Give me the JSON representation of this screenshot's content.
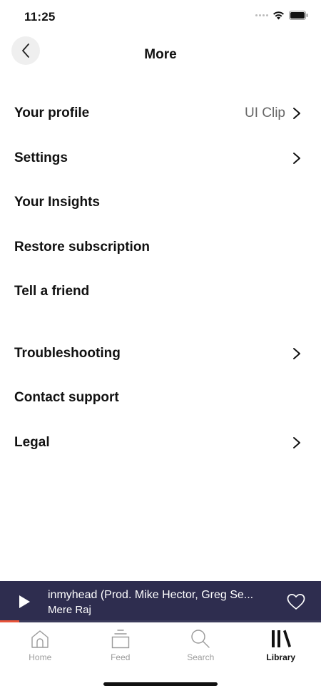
{
  "status_bar": {
    "time": "11:25",
    "icons": [
      "signal-dots-icon",
      "wifi-icon",
      "battery-icon"
    ]
  },
  "header": {
    "back_icon": "chevron-left-icon",
    "title": "More"
  },
  "menu": {
    "profile": {
      "label": "Your profile",
      "value": "UI Clip",
      "chevron": true
    },
    "settings": {
      "label": "Settings",
      "chevron": true
    },
    "insights": {
      "label": "Your Insights"
    },
    "restore": {
      "label": "Restore subscription"
    },
    "tell_friend": {
      "label": "Tell a friend"
    },
    "troubleshooting": {
      "label": "Troubleshooting",
      "chevron": true
    },
    "contact": {
      "label": "Contact support"
    },
    "legal": {
      "label": "Legal",
      "chevron": true
    }
  },
  "mini_player": {
    "title": "inmyhead (Prod. Mike Hector, Greg Se...",
    "artist": "Mere Raj",
    "progress": 0.06,
    "accent_color": "#e8543a",
    "background_color": "#2e2d4f"
  },
  "tab_bar": {
    "tabs": [
      {
        "label": "Home",
        "icon": "home-icon"
      },
      {
        "label": "Feed",
        "icon": "feed-icon"
      },
      {
        "label": "Search",
        "icon": "search-icon"
      },
      {
        "label": "Library",
        "icon": "library-icon",
        "active": true
      }
    ]
  }
}
